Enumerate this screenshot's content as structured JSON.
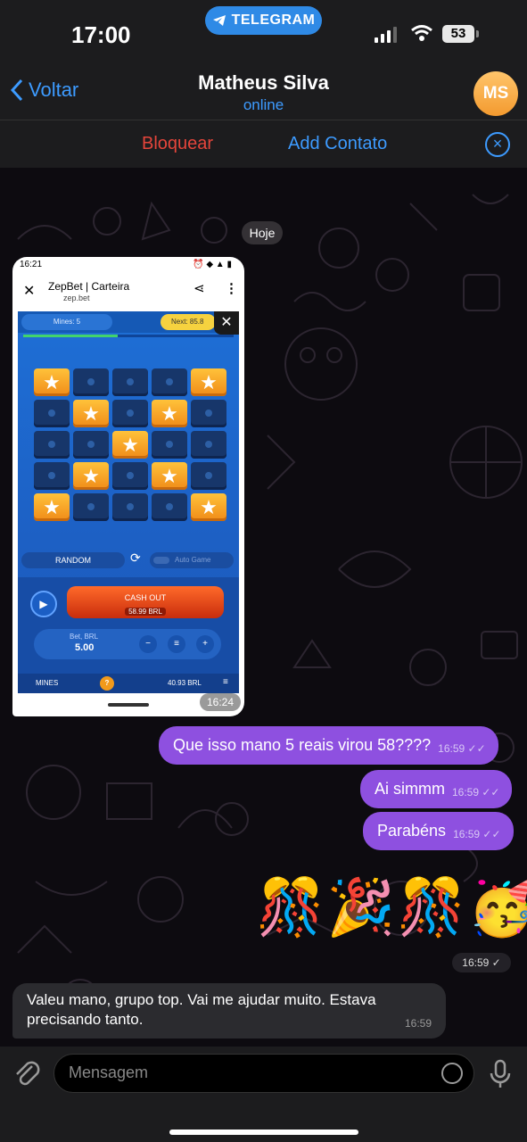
{
  "status_bar": {
    "time": "17:00",
    "app_pill": "TELEGRAM",
    "battery": "53"
  },
  "header": {
    "back_label": "Voltar",
    "contact_name": "Matheus Silva",
    "contact_status": "online",
    "avatar_initials": "MS",
    "block_label": "Bloquear",
    "add_contact_label": "Add Contato"
  },
  "chat": {
    "date_pill": "Hoje",
    "screenshot": {
      "phone_time": "16:21",
      "browser_title": "ZepBet | Carteira",
      "browser_domain": "zep.bet",
      "mines_select": "Mines: 5",
      "next_label": "Next: 85.8",
      "tiles": [
        "star",
        "dot",
        "dot",
        "dot",
        "star",
        "dot",
        "star",
        "dot",
        "star",
        "dot",
        "dot",
        "dot",
        "star",
        "dot",
        "dot",
        "dot",
        "star",
        "dot",
        "star",
        "dot",
        "star",
        "dot",
        "dot",
        "dot",
        "star"
      ],
      "random_label": "RANDOM",
      "auto_game_label": "Auto Game",
      "cash_out_label": "CASH OUT",
      "cash_out_amount": "58.99 BRL",
      "bet_label": "Bet, BRL",
      "bet_value": "5.00",
      "minus": "−",
      "plus": "+",
      "game_name": "MINES",
      "help": "?",
      "balance": "40.93 BRL",
      "time": "16:24"
    },
    "outgoing": [
      {
        "text": "Que isso mano 5 reais virou 58????",
        "time": "16:59"
      },
      {
        "text": "Ai simmm",
        "time": "16:59"
      },
      {
        "text": "Parabéns",
        "time": "16:59"
      }
    ],
    "emoji_message": {
      "emojis": [
        "🎊",
        "🎉",
        "🎊",
        "🥳"
      ],
      "time": "16:59"
    },
    "incoming_text": {
      "text": "Valeu mano, grupo top. Vai me ajudar muito. Estava precisando tanto.",
      "time": "16:59"
    }
  },
  "input": {
    "placeholder": "Mensagem"
  },
  "colors": {
    "accent": "#3d9bff",
    "outgoing_bubble": "#8e50e0",
    "danger": "#e5453b"
  }
}
